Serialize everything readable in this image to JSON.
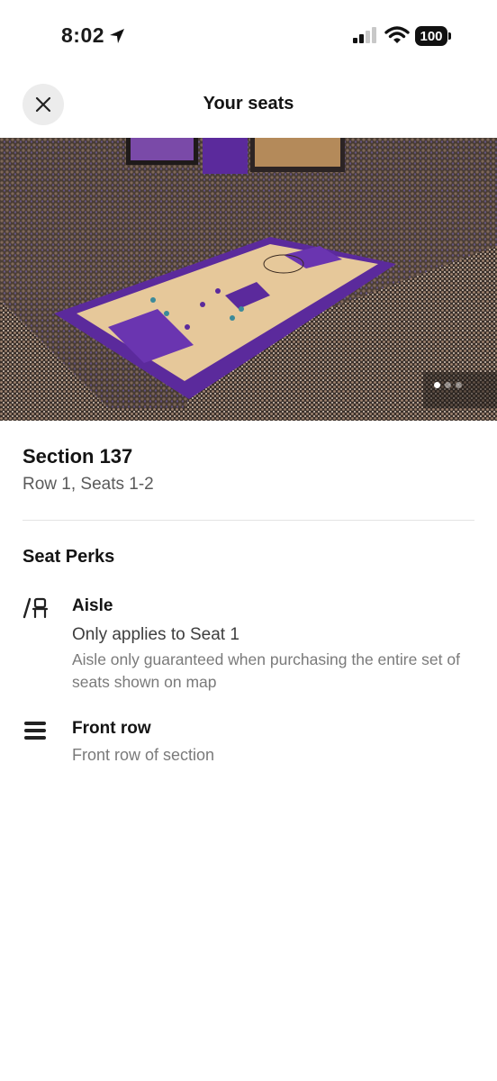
{
  "status_bar": {
    "time": "8:02",
    "battery": "100",
    "icons": [
      "location-arrow-icon",
      "cellular-signal-icon",
      "wifi-icon",
      "battery-icon"
    ]
  },
  "header": {
    "title": "Your seats",
    "close_icon": "close-icon"
  },
  "hero": {
    "image_description": "arena-photo",
    "carousel": {
      "total": 3,
      "active": 1
    }
  },
  "section": {
    "title": "Section 137",
    "subtitle": "Row 1, Seats 1-2"
  },
  "perks": {
    "heading": "Seat Perks",
    "items": [
      {
        "icon": "aisle-seat-icon",
        "title": "Aisle",
        "detail": "Only applies to Seat 1",
        "note": "Aisle only guaranteed when purchasing the entire set of seats shown on map"
      },
      {
        "icon": "front-row-icon",
        "title": "Front row",
        "detail": "Front row of section"
      }
    ]
  },
  "colors": {
    "court_purple": "#5b2a9c",
    "court_wood": "#e6c89a",
    "text_primary": "#141414",
    "text_secondary": "#5a5a5a",
    "text_muted": "#7a7a7a"
  }
}
